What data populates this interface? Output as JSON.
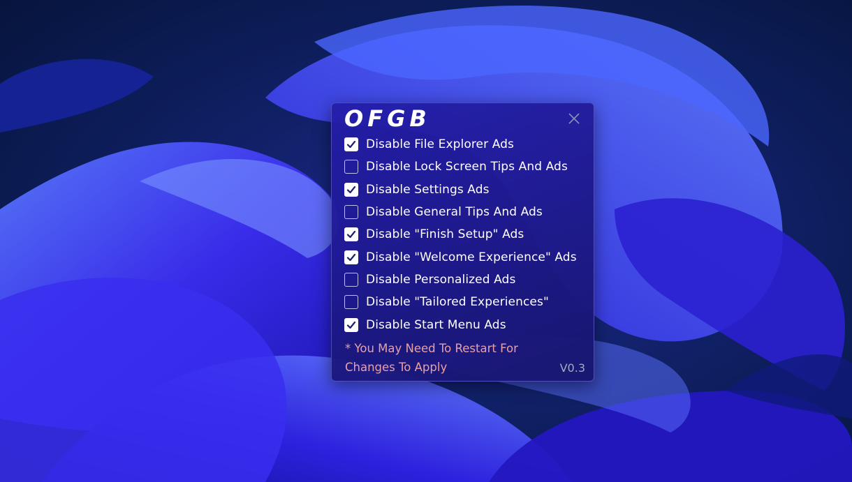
{
  "app": {
    "title": "OFGB",
    "close_label": "×",
    "version": "V0.3",
    "note": "* You May Need To Restart For Changes To Apply"
  },
  "options": [
    {
      "label": "Disable File Explorer Ads",
      "checked": true
    },
    {
      "label": "Disable Lock Screen Tips And Ads",
      "checked": false
    },
    {
      "label": "Disable Settings Ads",
      "checked": true
    },
    {
      "label": "Disable General Tips And Ads",
      "checked": false
    },
    {
      "label": "Disable \"Finish Setup\" Ads",
      "checked": true
    },
    {
      "label": "Disable \"Welcome Experience\" Ads",
      "checked": true
    },
    {
      "label": "Disable Personalized Ads",
      "checked": false
    },
    {
      "label": "Disable \"Tailored Experiences\"",
      "checked": false
    },
    {
      "label": "Disable Start Menu Ads",
      "checked": true
    }
  ],
  "colors": {
    "window_bg": "#2219a0",
    "text": "#ffffff",
    "note_text": "#e8a0a8",
    "version_text": "#a7a8c8",
    "wallpaper_accent": "#3a35ff"
  },
  "icons": {
    "close": "close-icon",
    "check": "checkmark-icon"
  }
}
